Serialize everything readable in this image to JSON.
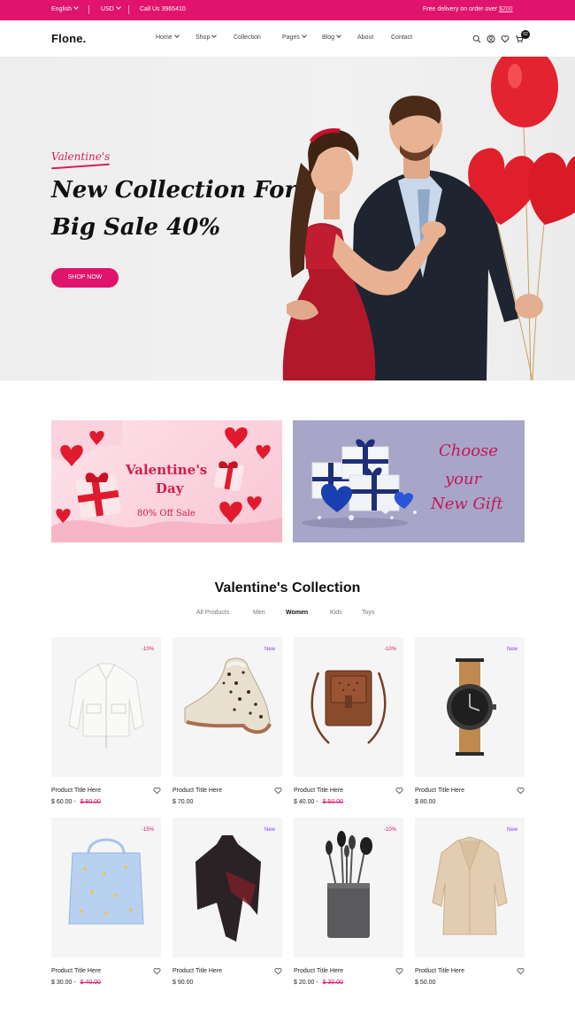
{
  "topbar": {
    "language": "English",
    "currency": "USD",
    "call": "Call Us 3965410",
    "delivery": "Free delivery on order over ",
    "delivery_amount": "$200",
    "bg_color": "#e0136d"
  },
  "header": {
    "logo": "Flone.",
    "nav": [
      "Home",
      "Shop",
      "Collection",
      "Pages",
      "Blog",
      "About",
      "Contact"
    ],
    "icons": [
      "search-icon",
      "account-icon",
      "wishlist-icon",
      "cart-icon"
    ],
    "cart_count": "02"
  },
  "hero": {
    "script": "Valentine's",
    "title_line1": "New Collection For",
    "title_line2": "Big Sale 40%",
    "button": "SHOP NOW"
  },
  "banners": {
    "left": {
      "line1": "Valentine's",
      "line2": "Day",
      "line3": "80% Off Sale"
    },
    "right": {
      "line1": "Choose",
      "line2": "your",
      "line3": "New Gift"
    }
  },
  "collection": {
    "title": "Valentine's Collection",
    "tabs": [
      "All Products",
      "Men",
      "Women",
      "Kids",
      "Toys"
    ],
    "active_tab": "Women"
  },
  "products": [
    {
      "title": "Product Title Here",
      "price": "$ 60.00",
      "old_price": "$ 80.00",
      "badge": "-10%",
      "badge_type": "sale",
      "image": "white-jacket"
    },
    {
      "title": "Product Title Here",
      "price": "$ 70.00",
      "old_price": "",
      "badge": "New",
      "badge_type": "new",
      "image": "leopard-shoe"
    },
    {
      "title": "Product Title Here",
      "price": "$ 40.00",
      "old_price": "$ 50.00",
      "badge": "-10%",
      "badge_type": "sale",
      "image": "leather-bag"
    },
    {
      "title": "Product Title Here",
      "price": "$ 80.00",
      "old_price": "",
      "badge": "New",
      "badge_type": "new",
      "image": "watch"
    },
    {
      "title": "Product Title Here",
      "price": "$ 30.00",
      "old_price": "$ 40.00",
      "badge": "-15%",
      "badge_type": "sale",
      "image": "tote-bag"
    },
    {
      "title": "Product Title Here",
      "price": "$ 90.00",
      "old_price": "",
      "badge": "New",
      "badge_type": "new",
      "image": "poncho"
    },
    {
      "title": "Product Title Here",
      "price": "$ 20.00",
      "old_price": "$ 30.00",
      "badge": "-10%",
      "badge_type": "sale",
      "image": "makeup-brushes"
    },
    {
      "title": "Product Title Here",
      "price": "$ 50.00",
      "old_price": "",
      "badge": "New",
      "badge_type": "new",
      "image": "beige-coat"
    }
  ]
}
